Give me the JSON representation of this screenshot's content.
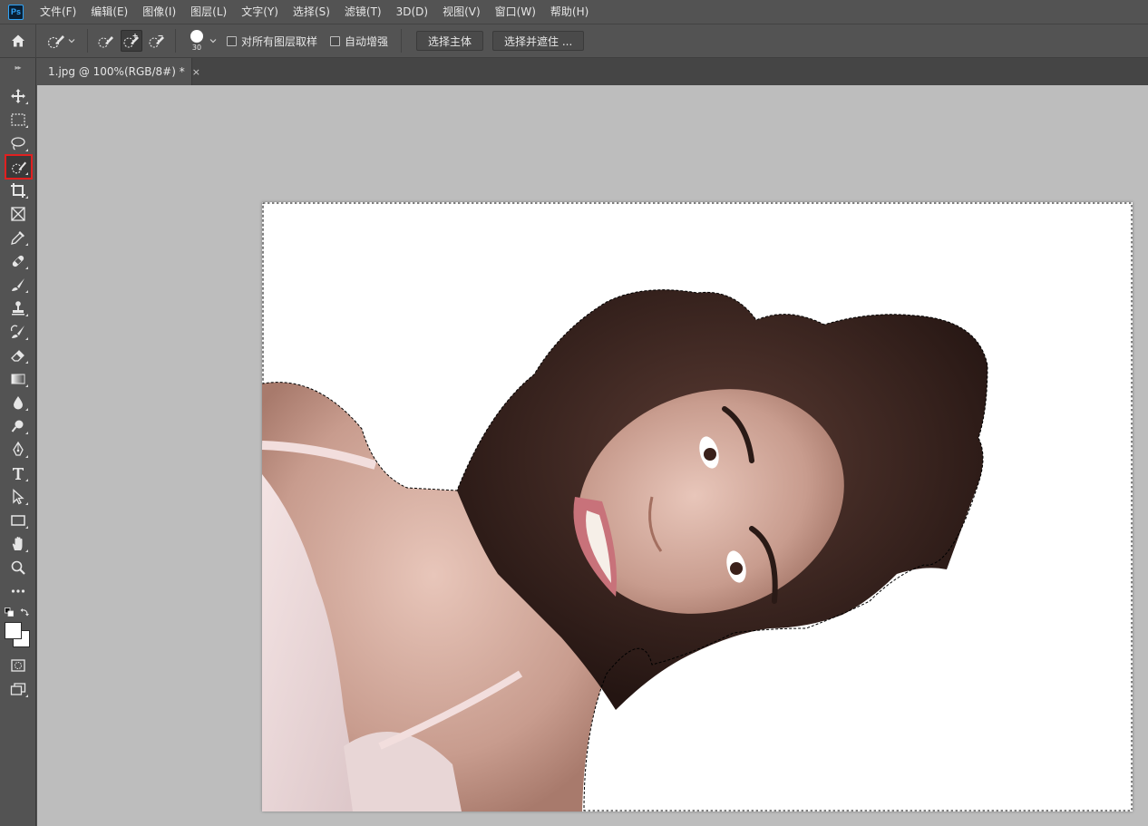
{
  "app": {
    "logo": "Ps"
  },
  "menu": [
    "文件(F)",
    "编辑(E)",
    "图像(I)",
    "图层(L)",
    "文字(Y)",
    "选择(S)",
    "滤镜(T)",
    "3D(D)",
    "视图(V)",
    "窗口(W)",
    "帮助(H)"
  ],
  "options": {
    "brush_size": "30",
    "sample_all_layers_label": "对所有图层取样",
    "auto_enhance_label": "自动增强",
    "select_subject_label": "选择主体",
    "select_and_mask_label": "选择并遮住 ..."
  },
  "document": {
    "tab_title": "1.jpg @ 100%(RGB/8#) *",
    "close_glyph": "×"
  },
  "toolbar": {
    "collapse_glyph": "▸▸",
    "selected_tool": "quick-selection-tool"
  },
  "colors": {
    "accent_selected_outline": "#e02020",
    "workspace": "#bdbdbd",
    "chrome": "#535353"
  }
}
